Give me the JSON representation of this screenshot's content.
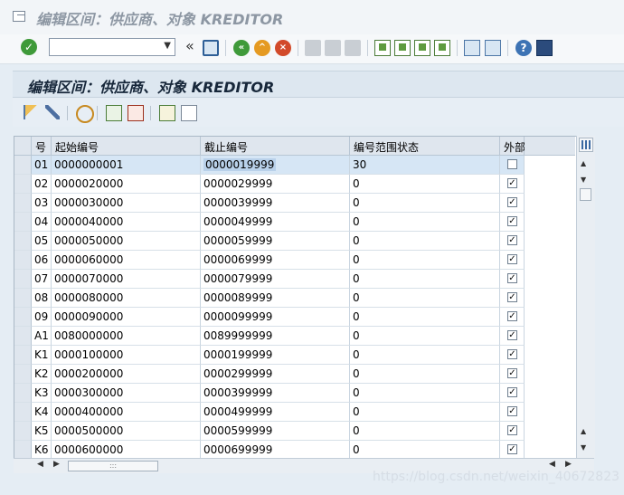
{
  "window": {
    "title": "编辑区间：供应商、对象 KREDITOR"
  },
  "toolbar": {
    "command_placeholder": "",
    "double_arrow": "«"
  },
  "screen": {
    "title": "编辑区间：供应商、对象 KREDITOR"
  },
  "table": {
    "headers": [
      "号",
      "起始编号",
      "截止编号",
      "编号范围状态",
      "外部"
    ],
    "rows": [
      [
        "01",
        "0000000001",
        "0000019999",
        "30",
        false
      ],
      [
        "02",
        "0000020000",
        "0000029999",
        "0",
        true
      ],
      [
        "03",
        "0000030000",
        "0000039999",
        "0",
        true
      ],
      [
        "04",
        "0000040000",
        "0000049999",
        "0",
        true
      ],
      [
        "05",
        "0000050000",
        "0000059999",
        "0",
        true
      ],
      [
        "06",
        "0000060000",
        "0000069999",
        "0",
        true
      ],
      [
        "07",
        "0000070000",
        "0000079999",
        "0",
        true
      ],
      [
        "08",
        "0000080000",
        "0000089999",
        "0",
        true
      ],
      [
        "09",
        "0000090000",
        "0000099999",
        "0",
        true
      ],
      [
        "A1",
        "0080000000",
        "0089999999",
        "0",
        true
      ],
      [
        "K1",
        "0000100000",
        "0000199999",
        "0",
        true
      ],
      [
        "K2",
        "0000200000",
        "0000299999",
        "0",
        true
      ],
      [
        "K3",
        "0000300000",
        "0000399999",
        "0",
        true
      ],
      [
        "K4",
        "0000400000",
        "0000499999",
        "0",
        true
      ],
      [
        "K5",
        "0000500000",
        "0000599999",
        "0",
        true
      ],
      [
        "K6",
        "0000600000",
        "0000699999",
        "0",
        true
      ]
    ]
  },
  "watermark": "https://blog.csdn.net/weixin_40672823"
}
